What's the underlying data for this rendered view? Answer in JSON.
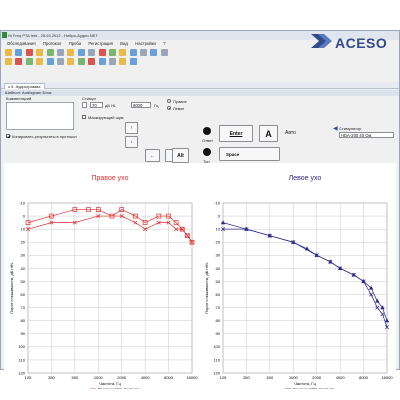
{
  "window": {
    "title": "Hi Freq PTA test - 25.03.2012 - Нейро-Аудио.NET"
  },
  "logo": {
    "text": "ACESO",
    "color": "#2f4c8b"
  },
  "menu": [
    "Обследования",
    "Протокол",
    "Проба",
    "Регистрация",
    "Вид",
    "Настройки",
    "?"
  ],
  "tab": {
    "label": "5. Аудиограмма",
    "close": "x"
  },
  "panel": {
    "title": "Шаблон: Audiogram Блок"
  },
  "controls": {
    "comment_label": "Комментарий",
    "copy_label": "Копировать результаты в протокол",
    "stimulus_label": "Стимул",
    "db_value": "70",
    "db_unit": "дБ HL",
    "freq_value": "6000",
    "freq_unit": "Гц",
    "masked_label": "Маскирующий шум",
    "right_label": "Правое",
    "left_label": "Левое",
    "nav_up": "↑",
    "nav_down": "↓",
    "nav_left": "←",
    "nav_right": "→",
    "alt_label": "Alt",
    "answer_label": "Ответ",
    "tone_label": "Тон",
    "enter_label": "Enter",
    "a_label": "A",
    "auto_label": "Авто",
    "space_label": "Space",
    "stimulator_label": "Стимулятор",
    "stimulator_value": "HDA-200 40 Ом"
  },
  "chart_data": [
    {
      "type": "line",
      "title": "Правое ухо",
      "color": "#e03030",
      "xlabel": "Частота, Гц",
      "ylabel": "Порог слышимости, дБ nHL",
      "x_ticks": [
        125,
        250,
        500,
        1000,
        2000,
        4000,
        8000,
        16000
      ],
      "y_ticks": [
        -10,
        0,
        10,
        20,
        30,
        40,
        50,
        60,
        70,
        80,
        90,
        100,
        110,
        120
      ],
      "ylim": [
        -10,
        120
      ],
      "series": [
        {
          "name": "Воздушная",
          "marker": "square",
          "points": [
            [
              125,
              5
            ],
            [
              250,
              0
            ],
            [
              500,
              -5
            ],
            [
              750,
              -5
            ],
            [
              1000,
              -5
            ],
            [
              1500,
              0
            ],
            [
              2000,
              -5
            ],
            [
              3000,
              0
            ],
            [
              4000,
              5
            ],
            [
              6000,
              0
            ],
            [
              8000,
              0
            ],
            [
              10000,
              5
            ],
            [
              12000,
              10
            ],
            [
              14000,
              15
            ],
            [
              16000,
              20
            ]
          ]
        },
        {
          "name": "Костная",
          "marker": "x",
          "points": [
            [
              125,
              10
            ],
            [
              250,
              5
            ],
            [
              500,
              5
            ],
            [
              1000,
              0
            ],
            [
              2000,
              0
            ],
            [
              3000,
              5
            ],
            [
              4000,
              10
            ],
            [
              6000,
              5
            ],
            [
              8000,
              5
            ],
            [
              10000,
              10
            ],
            [
              12000,
              10
            ],
            [
              14000,
              15
            ],
            [
              16000,
              20
            ]
          ]
        }
      ],
      "legend": [
        "Воздушная",
        "Костная"
      ]
    },
    {
      "type": "line",
      "title": "Левое ухо",
      "color": "#2a2a8a",
      "xlabel": "Частота, Гц",
      "ylabel": "Порог слышимости, дБ nHL",
      "x_ticks": [
        125,
        250,
        500,
        1000,
        2000,
        4000,
        8000,
        16000
      ],
      "y_ticks": [
        -10,
        0,
        10,
        20,
        30,
        40,
        50,
        60,
        70,
        80,
        90,
        100,
        110,
        120
      ],
      "ylim": [
        -10,
        120
      ],
      "series": [
        {
          "name": "Воздушная",
          "marker": "triangle",
          "points": [
            [
              125,
              5
            ],
            [
              250,
              10
            ],
            [
              500,
              15
            ],
            [
              1000,
              20
            ],
            [
              1500,
              25
            ],
            [
              2000,
              30
            ],
            [
              3000,
              35
            ],
            [
              4000,
              40
            ],
            [
              6000,
              45
            ],
            [
              8000,
              50
            ],
            [
              10000,
              55
            ],
            [
              12000,
              65
            ],
            [
              14000,
              70
            ],
            [
              16000,
              80
            ]
          ]
        },
        {
          "name": "Костная",
          "marker": "x",
          "points": [
            [
              125,
              10
            ],
            [
              250,
              10
            ],
            [
              500,
              15
            ],
            [
              1000,
              20
            ],
            [
              2000,
              30
            ],
            [
              3000,
              35
            ],
            [
              4000,
              40
            ],
            [
              6000,
              45
            ],
            [
              8000,
              50
            ],
            [
              10000,
              60
            ],
            [
              12000,
              70
            ],
            [
              14000,
              75
            ],
            [
              16000,
              85
            ]
          ]
        }
      ],
      "legend": [
        "Воздушная",
        "Костная"
      ]
    }
  ]
}
